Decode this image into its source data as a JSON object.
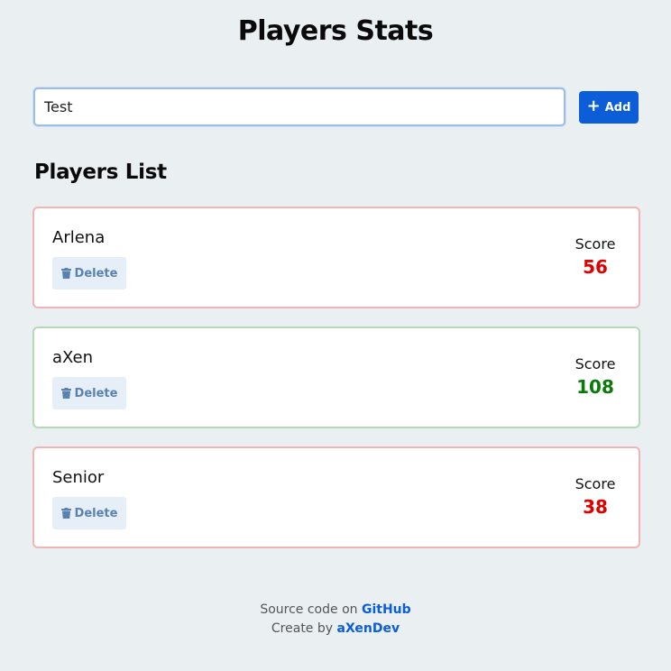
{
  "header": {
    "title": "Players Stats"
  },
  "add_form": {
    "input_value": "Test",
    "add_label": "Add",
    "add_icon": "plus-icon"
  },
  "list": {
    "title": "Players List",
    "score_label": "Score",
    "delete_label": "Delete",
    "delete_icon": "trash-icon",
    "players": [
      {
        "name": "Arlena",
        "score": "56"
      },
      {
        "name": "aXen",
        "score": "108"
      },
      {
        "name": "Senior",
        "score": "38"
      }
    ]
  },
  "footer": {
    "source_prefix": "Source code on",
    "source_link": "GitHub",
    "credit_prefix": "Create by",
    "credit_link": "aXenDev"
  },
  "colors": {
    "accent": "#0b5ed7",
    "score_low": "#e00000",
    "score_high": "#0a7a0a",
    "card_border_low": "#f0b4b4",
    "card_border_high": "#b5d9b5"
  }
}
